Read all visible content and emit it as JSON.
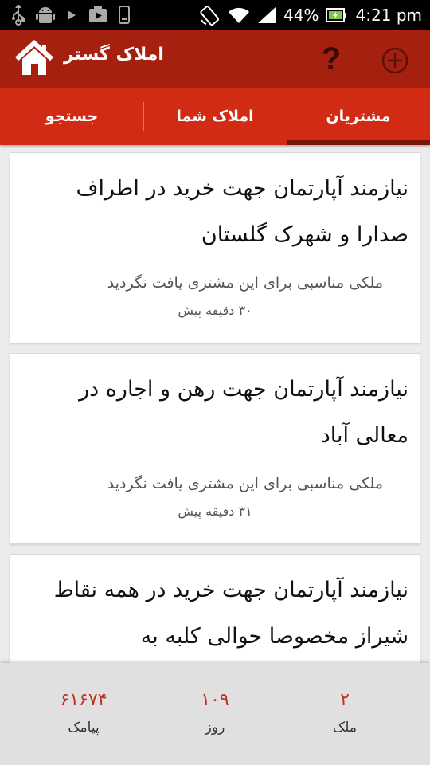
{
  "status_bar": {
    "battery": "44%",
    "time": "4:21 pm",
    "icons": [
      "usb-icon",
      "android-icon",
      "play-icon",
      "media-icon",
      "phone-icon",
      "rotate-icon",
      "wifi-icon",
      "signal-icon",
      "battery-icon"
    ]
  },
  "action_bar": {
    "title": "املاک گستر",
    "help_label": "?",
    "icons": [
      "home-icon",
      "help-icon",
      "add-icon"
    ]
  },
  "tabs": [
    {
      "label": "جستجو"
    },
    {
      "label": "املاک شما"
    },
    {
      "label": "مشتریان"
    }
  ],
  "active_tab": "مشتریان",
  "cards": [
    {
      "title": "نیازمند آپارتمان جهت خرید در اطراف صدارا و شهرک گلستان",
      "status": "ملکی مناسبی برای این مشتری یافت نگردید",
      "time": "۳۰ دقیقه پیش"
    },
    {
      "title": "نیازمند آپارتمان جهت رهن و اجاره در معالی آباد",
      "status": "ملکی مناسبی برای این مشتری یافت نگردید",
      "time": "۳۱ دقیقه پیش"
    },
    {
      "title": "نیازمند آپارتمان جهت خرید در همه نقاط شیراز مخصوصا حوالی کلبه به",
      "status": "",
      "time": ""
    }
  ],
  "footer": {
    "stats": [
      {
        "value": "۶۱۶۷۴",
        "label": "پیامک"
      },
      {
        "value": "۱۰۹",
        "label": "روز"
      },
      {
        "value": "۲",
        "label": "ملک"
      }
    ]
  },
  "colors": {
    "action_bar": "#a6200f",
    "tabs": "#d22b13",
    "tab_indicator": "#7a1408",
    "stat_value": "#c0311c"
  }
}
